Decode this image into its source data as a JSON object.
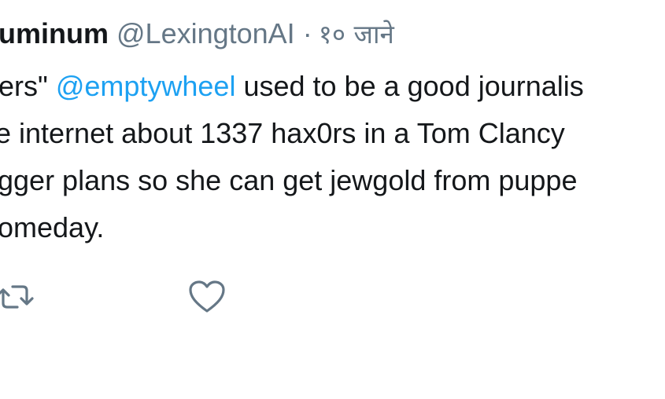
{
  "tweet": {
    "display_name": "uminum",
    "handle": "@LexingtonAI",
    "separator": "·",
    "timestamp": "१० जाने",
    "body": {
      "line1_prefix": "ers\"",
      "line1_mention": "@emptywheel",
      "line1_suffix": "used to be a good journalis",
      "line2": "e internet about 1337 hax0rs in a Tom Clancy",
      "line3": "gger plans so she can get jewgold from puppe",
      "line4": "omeday."
    }
  },
  "actions": {
    "retweet_icon": "retweet-icon",
    "like_icon": "heart-icon"
  },
  "colors": {
    "text": "#14171a",
    "secondary": "#657786",
    "link": "#1da1f2"
  }
}
